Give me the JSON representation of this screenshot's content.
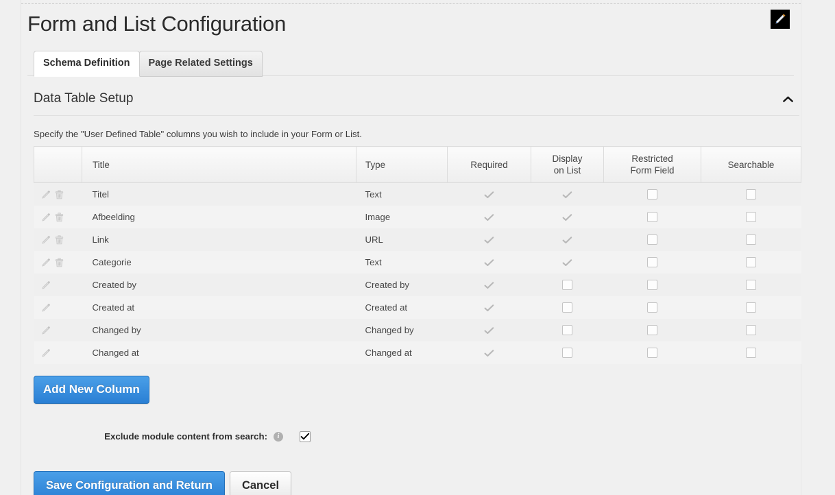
{
  "header": {
    "title": "Form and List Configuration",
    "edit_icon": "pencil-edit-icon"
  },
  "tabs": [
    {
      "label": "Schema Definition",
      "active": true
    },
    {
      "label": "Page Related Settings",
      "active": false
    }
  ],
  "section": {
    "title": "Data Table Setup",
    "collapse_icon": "chevron-up-icon",
    "description": "Specify the \"User Defined Table\" columns you wish to include in your Form or List."
  },
  "table": {
    "columns": [
      {
        "key": "actions",
        "label": ""
      },
      {
        "key": "title",
        "label": "Title"
      },
      {
        "key": "type",
        "label": "Type"
      },
      {
        "key": "required",
        "label": "Required"
      },
      {
        "key": "display",
        "label": "Display\non List",
        "line1": "Display",
        "line2": "on List"
      },
      {
        "key": "restricted",
        "label": "Restricted\nForm Field",
        "line1": "Restricted",
        "line2": "Form Field"
      },
      {
        "key": "searchable",
        "label": "Searchable"
      }
    ],
    "rows": [
      {
        "title": "Titel",
        "type": "Text",
        "edit": true,
        "delete": true,
        "required": "check",
        "display": "check",
        "restricted": "unchecked",
        "searchable": "unchecked"
      },
      {
        "title": "Afbeelding",
        "type": "Image",
        "edit": true,
        "delete": true,
        "required": "check",
        "display": "check",
        "restricted": "unchecked",
        "searchable": "unchecked"
      },
      {
        "title": "Link",
        "type": "URL",
        "edit": true,
        "delete": true,
        "required": "check",
        "display": "check",
        "restricted": "unchecked",
        "searchable": "unchecked"
      },
      {
        "title": "Categorie",
        "type": "Text",
        "edit": true,
        "delete": true,
        "required": "check",
        "display": "check",
        "restricted": "unchecked",
        "searchable": "unchecked"
      },
      {
        "title": "Created by",
        "type": "Created by",
        "edit": true,
        "delete": false,
        "required": "check",
        "display": "unchecked",
        "restricted": "unchecked",
        "searchable": "unchecked"
      },
      {
        "title": "Created at",
        "type": "Created at",
        "edit": true,
        "delete": false,
        "required": "check",
        "display": "unchecked",
        "restricted": "unchecked",
        "searchable": "unchecked"
      },
      {
        "title": "Changed by",
        "type": "Changed by",
        "edit": true,
        "delete": false,
        "required": "check",
        "display": "unchecked",
        "restricted": "unchecked",
        "searchable": "unchecked"
      },
      {
        "title": "Changed at",
        "type": "Changed at",
        "edit": true,
        "delete": false,
        "required": "check",
        "display": "unchecked",
        "restricted": "unchecked",
        "searchable": "unchecked"
      }
    ]
  },
  "actions": {
    "add_column_label": "Add New Column",
    "save_label": "Save Configuration and Return",
    "cancel_label": "Cancel"
  },
  "exclude": {
    "label": "Exclude module content from search:",
    "info_icon": "info-icon",
    "info_glyph": "i",
    "checked": true
  },
  "colors": {
    "accent": "#2a7fd4",
    "page_bg": "#f0f0f0",
    "row_odd": "#efefef",
    "row_even": "#f3f3f3",
    "text": "#474747"
  }
}
